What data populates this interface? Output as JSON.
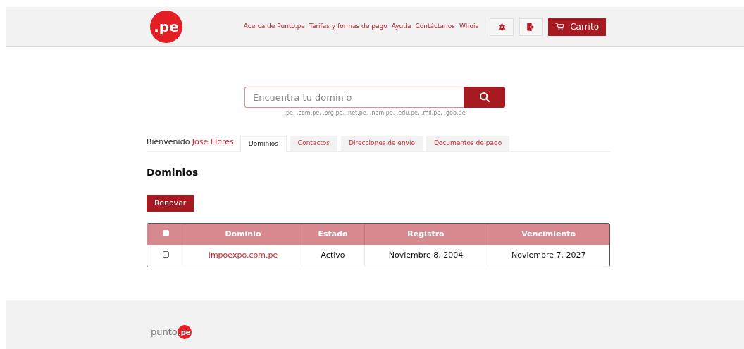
{
  "header": {
    "logo": ".pe",
    "nav": [
      "Acerca de Punto.pe",
      "Tarifas y formas de pago",
      "Ayuda",
      "Contáctanos",
      "Whois"
    ],
    "cart_button": "Carrito"
  },
  "search": {
    "placeholder": "Encuentra tu dominio",
    "extensions": ".pe, .com.pe, .org.pe, .net.pe, .nom.pe, .edu.pe, .mil.pe, .gob.pe"
  },
  "welcome": {
    "label": "Bienvenido",
    "user": "Jose Flores"
  },
  "tabs": [
    {
      "label": "Dominios",
      "selected": true
    },
    {
      "label": "Contactos",
      "selected": false
    },
    {
      "label": "Direcciones de envío",
      "selected": false
    },
    {
      "label": "Documentos de pago",
      "selected": false
    }
  ],
  "section_title": "Dominios",
  "renew_button": "Renovar",
  "table": {
    "select_all_checked": false,
    "columns": [
      "Dominio",
      "Estado",
      "Registro",
      "Vencimiento"
    ],
    "rows": [
      {
        "checked": false,
        "cells": [
          "impoexpo.com.pe",
          "Activo",
          "Noviembre 8, 2004",
          "Noviembre 7, 2027"
        ]
      }
    ]
  },
  "footer": {
    "logo_text": "punto",
    "logo_badge": ".pe"
  }
}
